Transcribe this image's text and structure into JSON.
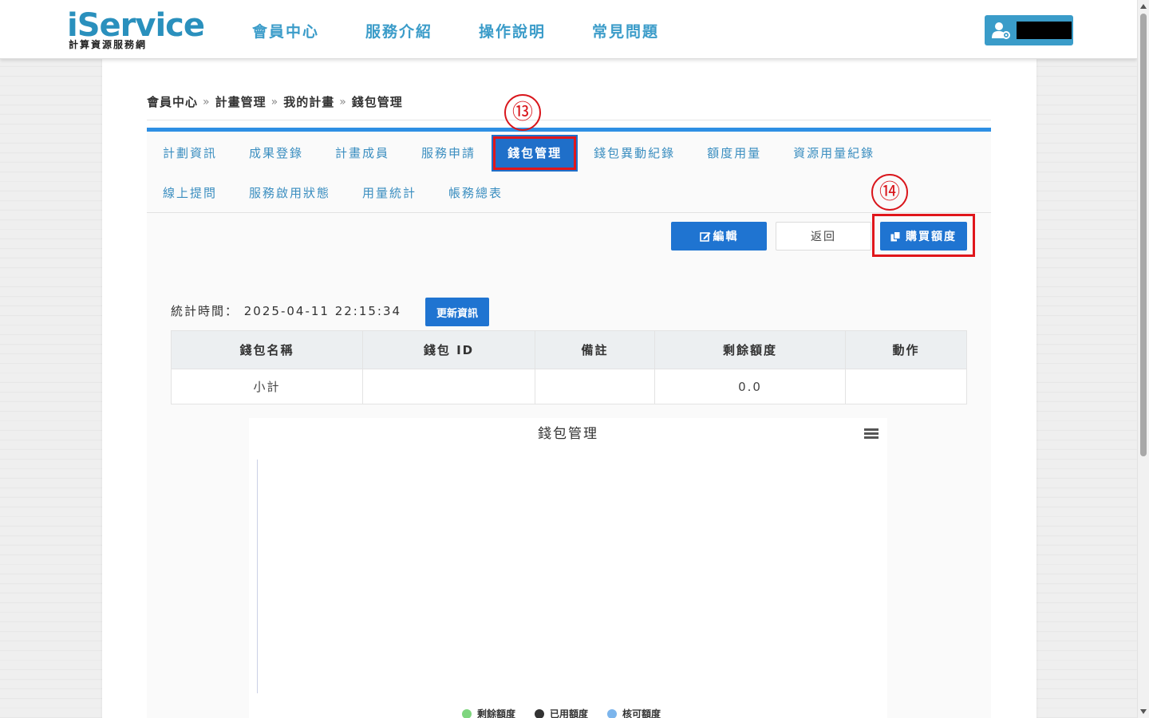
{
  "logo": {
    "main": "iService",
    "sub": "計算資源服務網"
  },
  "nav": {
    "items": [
      "會員中心",
      "服務介紹",
      "操作說明",
      "常見問題"
    ]
  },
  "user": {
    "name": ""
  },
  "breadcrumb": [
    "會員中心",
    "計畫管理",
    "我的計畫",
    "錢包管理"
  ],
  "tabs": {
    "row1": [
      "計劃資訊",
      "成果登錄",
      "計畫成員",
      "服務申請",
      "錢包管理",
      "錢包異動紀錄",
      "額度用量",
      "資源用量紀錄"
    ],
    "row2": [
      "線上提問",
      "服務啟用狀態",
      "用量統計",
      "帳務總表"
    ],
    "active": "錢包管理"
  },
  "annotations": {
    "step13": "⑬",
    "step14": "⑭"
  },
  "actions": {
    "edit": "編輯",
    "back": "返回",
    "buy": "購買額度"
  },
  "stats": {
    "label": "統計時間： 2025-04-11 22:15:34",
    "refresh": "更新資訊"
  },
  "table": {
    "headers": [
      "錢包名稱",
      "錢包 ID",
      "備註",
      "剩餘額度",
      "動作"
    ],
    "rows": [
      [
        "小計",
        "",
        "",
        "0.0",
        ""
      ]
    ]
  },
  "chart": {
    "title": "錢包管理",
    "legend": [
      {
        "label": "剩餘額度",
        "color": "#7ed57e"
      },
      {
        "label": "已用額度",
        "color": "#333333"
      },
      {
        "label": "核可額度",
        "color": "#7cb5ec"
      }
    ]
  },
  "chart_data": {
    "type": "bar",
    "title": "錢包管理",
    "categories": [],
    "series": [
      {
        "name": "剩餘額度",
        "values": []
      },
      {
        "name": "已用額度",
        "values": []
      },
      {
        "name": "核可額度",
        "values": []
      }
    ]
  },
  "colors": {
    "brand": "#3a9cc9",
    "primary": "#1f74d1",
    "tabs_border": "#2e8fe4",
    "annotation": "#e0161b"
  }
}
